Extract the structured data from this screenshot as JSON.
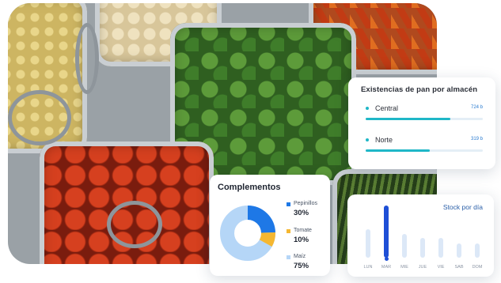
{
  "photo": {
    "subject": "food-trays"
  },
  "stock_card": {
    "title": "Existencias de pan por almacén",
    "rows": [
      {
        "name": "Central",
        "value": "724 b",
        "fill": 0.72
      },
      {
        "name": "Norte",
        "value": "319 b",
        "fill": 0.55
      }
    ]
  },
  "complements_card": {
    "title": "Complementos",
    "items": [
      {
        "name": "Pepinillos",
        "value": "30%",
        "color": "#1e78e6"
      },
      {
        "name": "Tomate",
        "value": "10%",
        "color": "#f5b731"
      },
      {
        "name": "Maíz",
        "value": "75%",
        "color": "#b5d6f7"
      }
    ]
  },
  "daily_card": {
    "title": "Stock por día",
    "days": [
      "LUN",
      "MAR",
      "MIE",
      "JUE",
      "VIE",
      "SAB",
      "DOM"
    ],
    "values": [
      0.55,
      1.0,
      0.45,
      0.38,
      0.38,
      0.28,
      0.28
    ],
    "active_index": 1
  },
  "colors": {
    "accent": "#1fb7c7",
    "primary": "#1e4fd6"
  }
}
